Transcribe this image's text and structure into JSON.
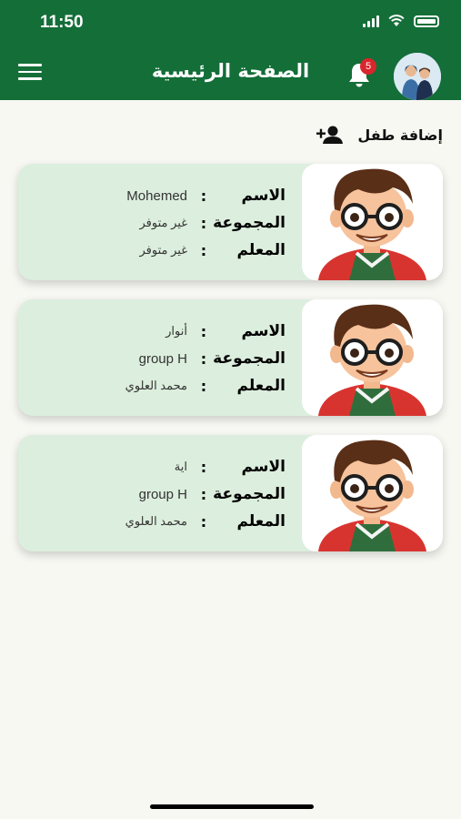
{
  "status": {
    "time": "11:50"
  },
  "header": {
    "title": "الصفحة الرئيسية",
    "notification_count": "5"
  },
  "add_child": {
    "label": "إضافة طفل"
  },
  "children": [
    {
      "name_label": "الاسم",
      "name": "Mohemed",
      "group_label": "المجموعة",
      "group": "غير متوفر",
      "teacher_label": "المعلم",
      "teacher": "غير متوفر"
    },
    {
      "name_label": "الاسم",
      "name": "أنوار",
      "group_label": "المجموعة",
      "group": "group H",
      "teacher_label": "المعلم",
      "teacher": "محمد العلوي"
    },
    {
      "name_label": "الاسم",
      "name": "اية",
      "group_label": "المجموعة",
      "group": "group H",
      "teacher_label": "المعلم",
      "teacher": "محمد العلوي"
    }
  ],
  "colors": {
    "header": "#136e38",
    "card": "#dceedd",
    "badge": "#d8262c",
    "background": "#f8f8f3"
  }
}
